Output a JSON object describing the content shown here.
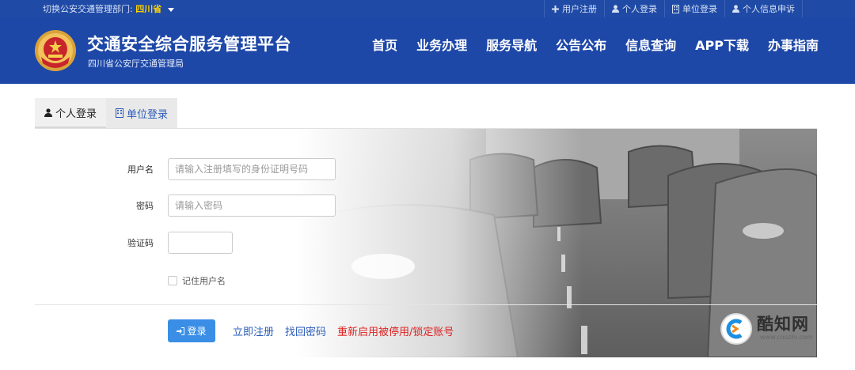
{
  "topbar": {
    "dept_label": "切换公安交通管理部门:",
    "dept_value": "四川省",
    "links": [
      "用户注册",
      "个人登录",
      "单位登录",
      "个人信息申诉"
    ]
  },
  "header": {
    "title": "交通安全综合服务管理平台",
    "subtitle": "四川省公安厅交通管理局",
    "nav": [
      "首页",
      "业务办理",
      "服务导航",
      "公告公布",
      "信息查询",
      "APP下载",
      "办事指南"
    ]
  },
  "login": {
    "tabs": [
      "个人登录",
      "单位登录"
    ],
    "username_label": "用户名",
    "username_placeholder": "请输入注册填写的身份证明号码",
    "password_label": "密码",
    "password_placeholder": "请输入密码",
    "captcha_label": "验证码",
    "remember_label": "记住用户名",
    "login_button": "登录",
    "register_link": "立即注册",
    "recover_link": "找回密码",
    "reactivate_link": "重新启用被停用/锁定账号"
  },
  "watermark": {
    "name": "酷知网",
    "url": "www.coozhi.com"
  },
  "colors": {
    "header_bg": "#1e48a8",
    "topbar_bg": "#1f4aa6",
    "dept_highlight": "#ffd200",
    "login_button": "#3a8ee6",
    "link_blue": "#2a5bb8",
    "link_red": "#e02020"
  }
}
